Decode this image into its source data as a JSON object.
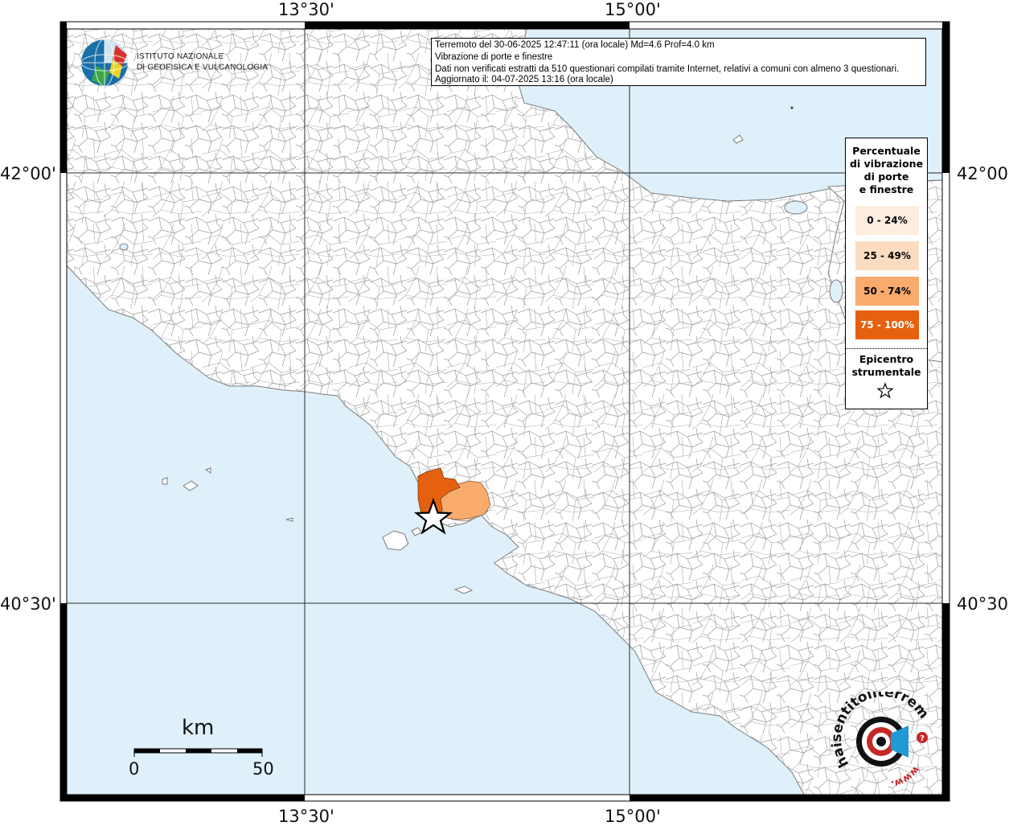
{
  "map": {
    "ticks": {
      "lon_west": "13°30'",
      "lon_east": "15°00'",
      "lat_north": "42°00'",
      "lat_south": "40°30'"
    },
    "colors": {
      "sea": "#dff0fb",
      "land": "#ffffff",
      "class_0_24": "#fdeee0",
      "class_25_49": "#fcdcc0",
      "class_50_74": "#f8ab6c",
      "class_75_100": "#e6610f"
    }
  },
  "logo": {
    "line1": "ISTITUTO NAZIONALE",
    "line2": "DI GEOFISICA E VULCANOLOGIA"
  },
  "info": {
    "line1": "Terremoto del 30-06-2025 12:47:11 (ora locale) Md=4.6 Prof=4.0 km",
    "line2": "Vibrazione di porte e finestre",
    "line3": "Dati non verificati estratti da 510 questionari compilati tramite Internet, relativi a comuni con almeno 3 questionari.",
    "line4": "Aggiornato il: 04-07-2025 13:16 (ora locale)"
  },
  "legend": {
    "title_l1": "Percentuale",
    "title_l2": "di vibrazione",
    "title_l3": "di porte",
    "title_l4": "e finestre",
    "items": [
      "0 - 24%",
      "25 - 49%",
      "50 - 74%",
      "75 - 100%"
    ],
    "epicenter_l1": "Epicentro",
    "epicenter_l2": "strumentale",
    "star_icon": "star-outline-icon"
  },
  "scale": {
    "unit": "km",
    "min": "0",
    "max": "50"
  },
  "badge": {
    "text_top": "haisentitoilterremoto.it",
    "text_www": "www.",
    "icon": "earthquake-target-icon"
  }
}
